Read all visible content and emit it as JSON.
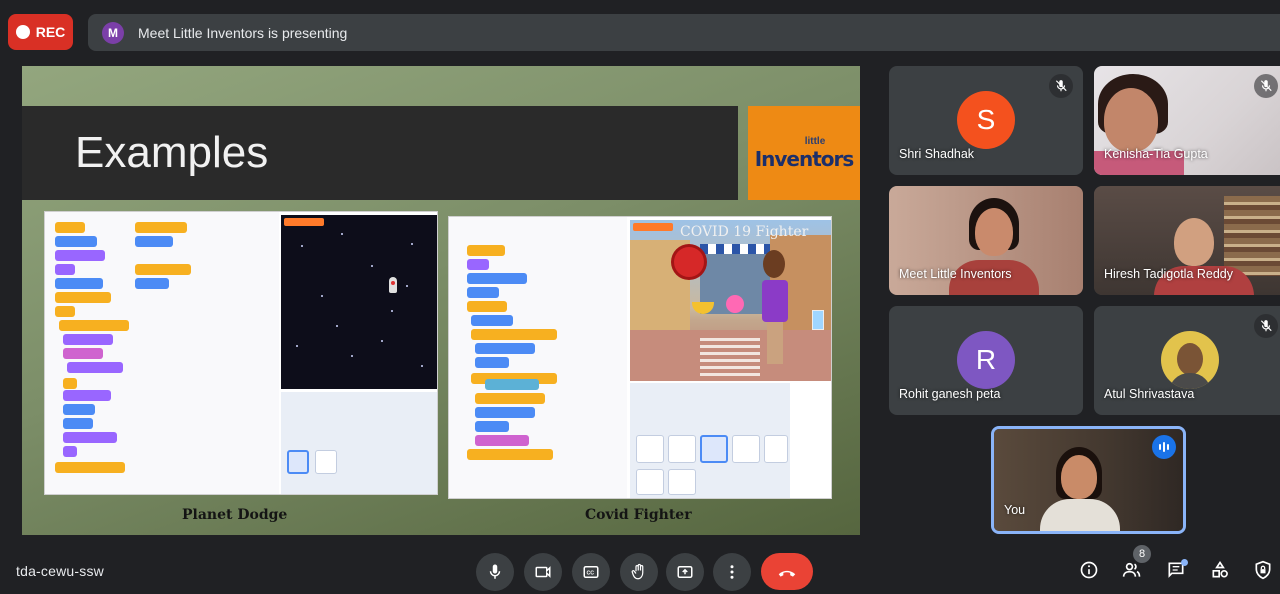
{
  "recording": {
    "label": "REC"
  },
  "presenting": {
    "avatar_letter": "M",
    "text": "Meet Little Inventors is presenting"
  },
  "slide": {
    "title": "Examples",
    "logo_top": "little",
    "logo_main": "Inventors",
    "example1_caption": "Planet Dodge",
    "example2_caption": "Covid Fighter",
    "game_title": "COVID 19 Fighter"
  },
  "participants": [
    {
      "name": "Shri Shadhak",
      "avatar_letter": "S",
      "avatar_color": "#f4511e",
      "muted": true
    },
    {
      "name": "Kenisha-Tia Gupta",
      "muted": true
    },
    {
      "name": "Meet Little Inventors",
      "muted": false
    },
    {
      "name": "Hiresh Tadigotla Reddy",
      "muted": false
    },
    {
      "name": "Rohit ganesh peta",
      "avatar_letter": "R",
      "avatar_color": "#7e57c2",
      "muted": false
    },
    {
      "name": "Atul Shrivastava",
      "muted": true
    }
  ],
  "self_tile": {
    "name": "You"
  },
  "bottom_bar": {
    "meeting_code": "tda-cewu-ssw",
    "people_count": "8"
  },
  "colors": {
    "end_call": "#ea4335",
    "rec": "#d93025",
    "active_speaker": "#8ab4f8"
  }
}
